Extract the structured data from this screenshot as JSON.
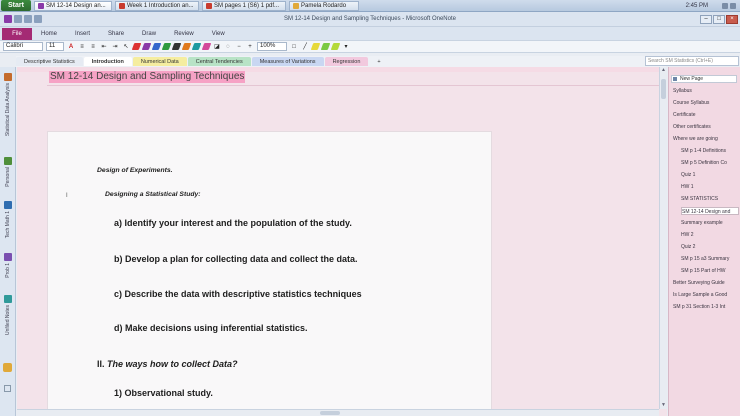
{
  "taskbar": {
    "start_label": "Start",
    "tasks": [
      {
        "label": "SM 12-14 Design an..."
      },
      {
        "label": "Week 1 Introduction an..."
      },
      {
        "label": "SM pages 1 (S6) 1 pdf..."
      },
      {
        "label": "Pamela Rodardo"
      }
    ],
    "clock": "2:45 PM"
  },
  "titlebar": {
    "title": "SM 12-14 Design and Sampling Techniques - Microsoft OneNote"
  },
  "ribbon": {
    "file_tab": "File",
    "tabs": [
      "Home",
      "Insert",
      "Share",
      "Draw",
      "Review",
      "View"
    ]
  },
  "toolbar": {
    "font": "Calibri",
    "size": "11",
    "zoom": "100%"
  },
  "sections": [
    {
      "label": "Descriptive Statistics",
      "color": "#e6ebf3"
    },
    {
      "label": "Introduction",
      "color": "#ffffff"
    },
    {
      "label": "Numerical Data",
      "color": "#f5eda0"
    },
    {
      "label": "Central Tendencies",
      "color": "#b8e3c6"
    },
    {
      "label": "Measures of Variations",
      "color": "#c9d7f2"
    },
    {
      "label": "Regression",
      "color": "#f2c9de"
    },
    {
      "label": "+",
      "color": "#eef1f6"
    }
  ],
  "search": {
    "placeholder": "Search SM Statistics (Ctrl+E)"
  },
  "notebooks": [
    {
      "label": "Statistical Data Analysis",
      "color": "#c46b2c"
    },
    {
      "label": "Personal",
      "color": "#4f8f3a"
    },
    {
      "label": "Tech Math 1",
      "color": "#2f6db0"
    },
    {
      "label": "Prob 1",
      "color": "#7a4fb0"
    },
    {
      "label": "Unfiled Notes",
      "color": "#2f9a9a"
    }
  ],
  "page": {
    "title": "SM 12-14 Design and Sampling Techniques",
    "heading": "Design of Experiments.",
    "subheading": "Designing a Statistical Study:",
    "items": [
      "a) Identify your interest  and the population of the study.",
      "b) Develop a plan for collecting data and collect the data.",
      "c) Describe the data with descriptive statistics techniques",
      "d) Make decisions using inferential statistics."
    ],
    "section2_prefix": "II. ",
    "section2_title": "The ways how to collect Data?",
    "section2_item": "1) Observational study."
  },
  "page_list": {
    "new_page": "New Page",
    "pages": [
      {
        "label": "Syllabus",
        "level": "top"
      },
      {
        "label": "Course Syllabus",
        "level": "top"
      },
      {
        "label": "Certificate",
        "level": "top"
      },
      {
        "label": "Other certificates",
        "level": "top"
      },
      {
        "label": "Where we are going",
        "level": "top"
      },
      {
        "label": "SM p 1-4 Definitions",
        "level": "sub"
      },
      {
        "label": "SM p 5 Definition  Co",
        "level": "sub"
      },
      {
        "label": "Quiz 1",
        "level": "sub"
      },
      {
        "label": "HW 1",
        "level": "sub"
      },
      {
        "label": "SM STATISTICS",
        "level": "sub"
      },
      {
        "label": "SM 12-14 Design and",
        "level": "sub",
        "selected": true
      },
      {
        "label": "Summary example",
        "level": "sub"
      },
      {
        "label": "HW 2",
        "level": "sub"
      },
      {
        "label": "Quiz 2",
        "level": "sub"
      },
      {
        "label": "SM p 15 a3 Summary",
        "level": "sub"
      },
      {
        "label": "SM p 15 Part of HW",
        "level": "sub"
      },
      {
        "label": "Better Surveying Guide",
        "level": "top"
      },
      {
        "label": "Is Large Sample a Good",
        "level": "top"
      },
      {
        "label": "SM p 31 Section 1-3 Int",
        "level": "top"
      }
    ]
  }
}
